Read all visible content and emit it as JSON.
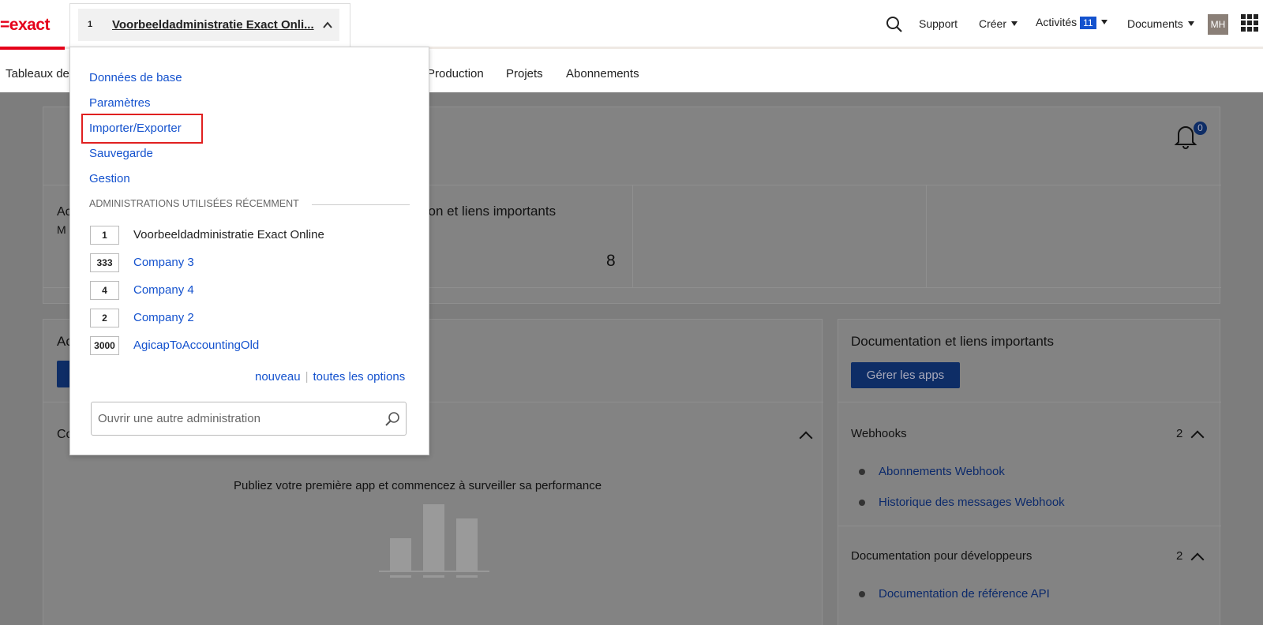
{
  "header": {
    "logo": "=exact",
    "admin": {
      "number": "1",
      "name": "Voorbeeldadministratie Exact Onli..."
    },
    "support": "Support",
    "create": "Créer",
    "activities": "Activités",
    "activities_count": "11",
    "documents": "Documents",
    "avatar_initials": "MH"
  },
  "nav": {
    "items": [
      "Tableaux de",
      "Production",
      "Projets",
      "Abonnements"
    ]
  },
  "background": {
    "card_partial_1": "Ac",
    "card_partial_2": "M",
    "doc_partial": "tion et liens importants",
    "count": "8",
    "notif_count": "0",
    "left_title_partial": "Ac",
    "left_section_partial": "Co",
    "empty_text": "Publiez votre première app et commencez à surveiller sa performance",
    "right_card": {
      "title": "Documentation et liens importants",
      "button": "Gérer les apps",
      "webhooks": {
        "label": "Webhooks",
        "count": "2",
        "links": [
          "Abonnements Webhook",
          "Historique des messages Webhook"
        ]
      },
      "dev_docs": {
        "label": "Documentation pour développeurs",
        "count": "2",
        "links": [
          "Documentation de référence API"
        ]
      }
    }
  },
  "dropdown": {
    "menu": [
      "Données de base",
      "Paramètres",
      "Importer/Exporter",
      "Sauvegarde",
      "Gestion"
    ],
    "recent_heading": "ADMINISTRATIONS UTILISÉES RÉCEMMENT",
    "recent": [
      {
        "number": "1",
        "name": "Voorbeeldadministratie Exact Online",
        "current": true
      },
      {
        "number": "333",
        "name": "Company 3",
        "current": false
      },
      {
        "number": "4",
        "name": "Company 4",
        "current": false
      },
      {
        "number": "2",
        "name": "Company 2",
        "current": false
      },
      {
        "number": "3000",
        "name": "AgicapToAccountingOld",
        "current": false
      }
    ],
    "new_link": "nouveau",
    "all_options_link": "toutes les options",
    "search_placeholder": "Ouvrir une autre administration"
  }
}
